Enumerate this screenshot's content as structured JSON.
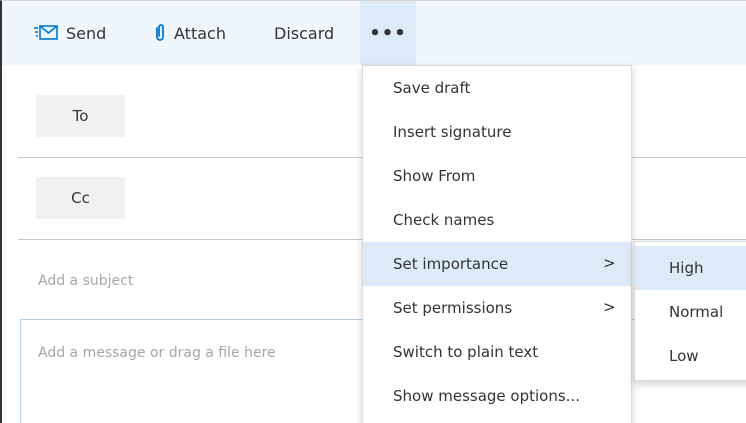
{
  "toolbar": {
    "send_label": "Send",
    "attach_label": "Attach",
    "discard_label": "Discard",
    "more_label": "•••"
  },
  "recipients": {
    "to_label": "To",
    "cc_label": "Cc"
  },
  "compose": {
    "subject_placeholder": "Add a subject",
    "body_placeholder": "Add a message or drag a file here"
  },
  "menu": {
    "items": [
      {
        "label": "Save draft"
      },
      {
        "label": "Insert signature"
      },
      {
        "label": "Show From"
      },
      {
        "label": "Check names"
      },
      {
        "label": "Set importance",
        "submenu_chevron": ">"
      },
      {
        "label": "Set permissions",
        "submenu_chevron": ">"
      },
      {
        "label": "Switch to plain text"
      },
      {
        "label": "Show message options..."
      }
    ]
  },
  "importance_submenu": {
    "items": [
      {
        "label": "High"
      },
      {
        "label": "Normal"
      },
      {
        "label": "Low"
      }
    ]
  },
  "colors": {
    "toolbar_bg": "#eff6fc",
    "accent_blue": "#0078d7",
    "hover_bg": "#dcebf7"
  },
  "icons": {
    "send": "send-envelope-icon",
    "attach": "paperclip-icon",
    "more": "ellipsis-icon",
    "submenu": "chevron-right-icon"
  }
}
